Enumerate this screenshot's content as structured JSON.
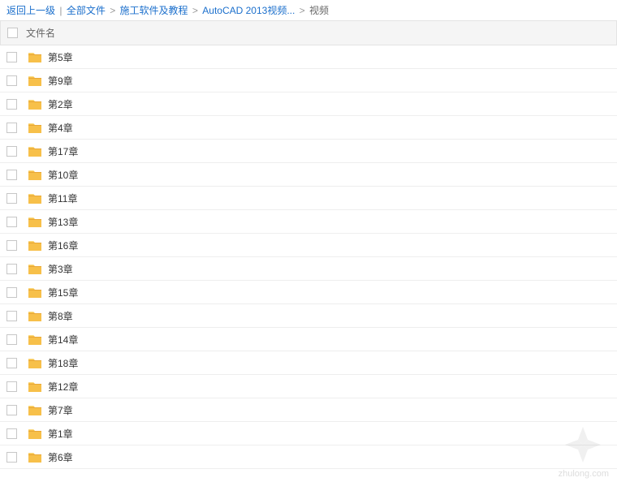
{
  "breadcrumb": {
    "back": "返回上一级",
    "divider": "|",
    "sep": ">",
    "items": [
      {
        "label": "全部文件",
        "link": true
      },
      {
        "label": "施工软件及教程",
        "link": true
      },
      {
        "label": "AutoCAD 2013视频...",
        "link": true
      },
      {
        "label": "视频",
        "link": false
      }
    ]
  },
  "header": {
    "filename": "文件名"
  },
  "files": [
    {
      "name": "第5章"
    },
    {
      "name": "第9章"
    },
    {
      "name": "第2章"
    },
    {
      "name": "第4章"
    },
    {
      "name": "第17章"
    },
    {
      "name": "第10章"
    },
    {
      "name": "第11章"
    },
    {
      "name": "第13章"
    },
    {
      "name": "第16章"
    },
    {
      "name": "第3章"
    },
    {
      "name": "第15章"
    },
    {
      "name": "第8章"
    },
    {
      "name": "第14章"
    },
    {
      "name": "第18章"
    },
    {
      "name": "第12章"
    },
    {
      "name": "第7章"
    },
    {
      "name": "第1章"
    },
    {
      "name": "第6章"
    }
  ],
  "watermark": "zhulong.com"
}
